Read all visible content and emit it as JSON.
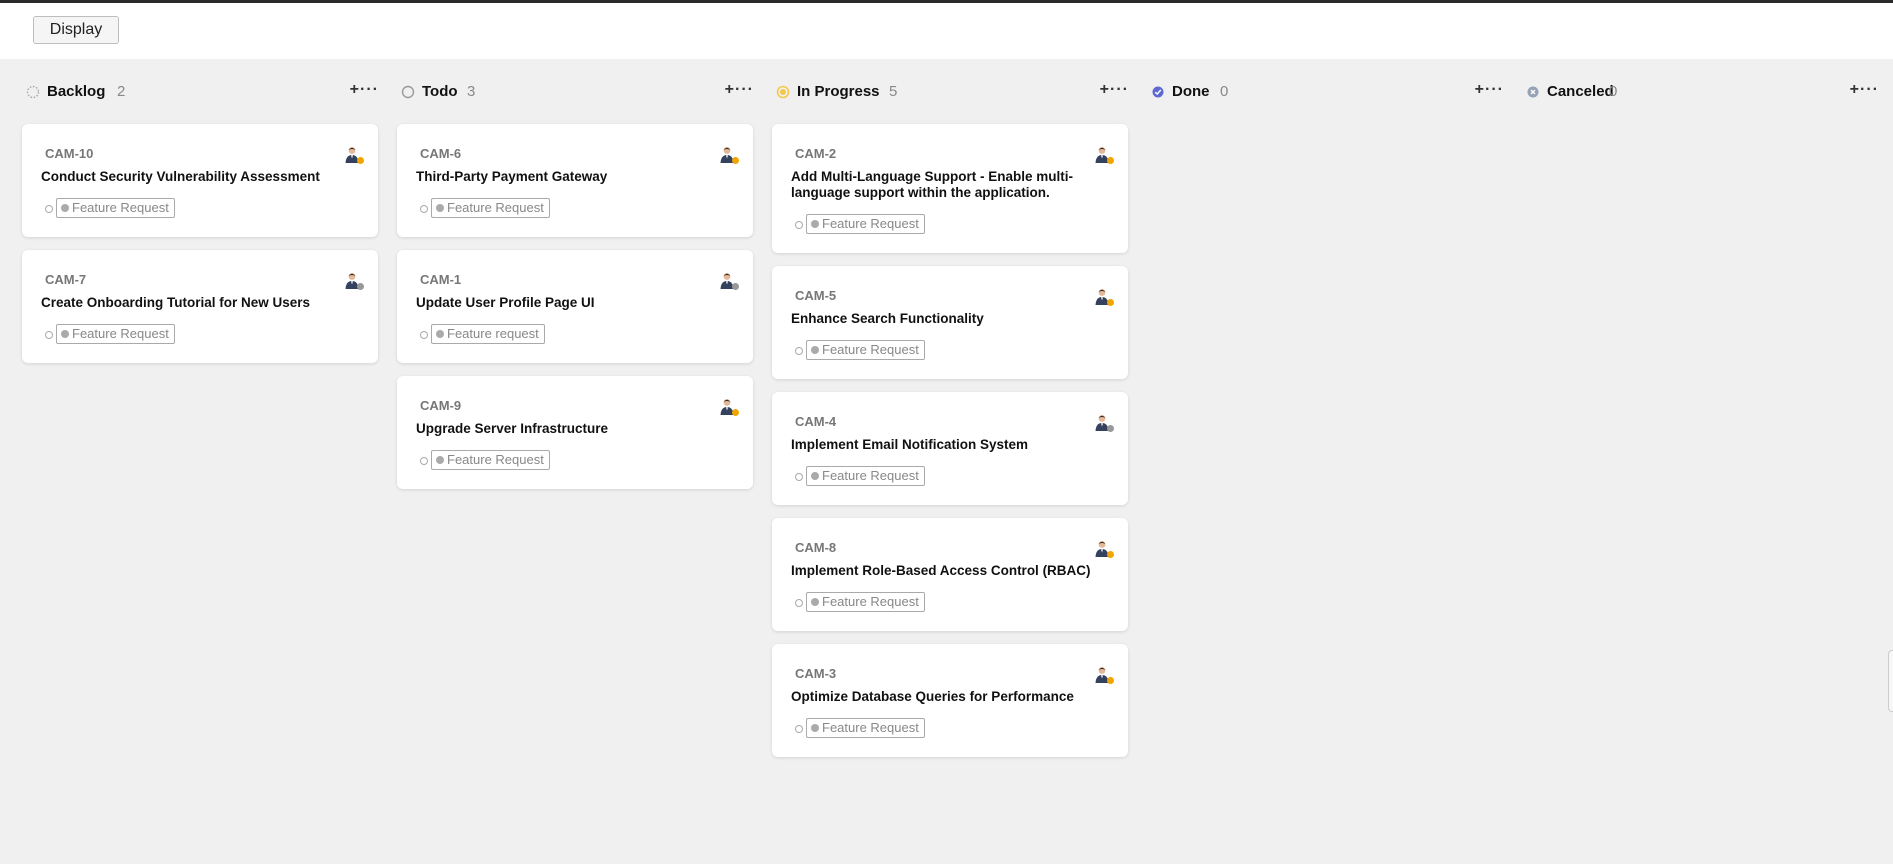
{
  "toolbar": {
    "display_label": "Display"
  },
  "columns": [
    {
      "title": "Backlog",
      "count": "2",
      "status": "backlog",
      "color": "#aaaaaa",
      "add_label": "+",
      "more_label": "···",
      "cards": [
        {
          "id": "CAM-10",
          "title": "Conduct Security Vulnerability Assessment",
          "label": "Feature Request",
          "avatar_status": "#f0a500"
        },
        {
          "id": "CAM-7",
          "title": "Create Onboarding Tutorial for New Users",
          "label": "Feature Request",
          "avatar_status": "#999999"
        }
      ]
    },
    {
      "title": "Todo",
      "count": "3",
      "status": "todo",
      "color": "#999999",
      "add_label": "+",
      "more_label": "···",
      "cards": [
        {
          "id": "CAM-6",
          "title": "Third-Party Payment Gateway",
          "label": "Feature Request",
          "avatar_status": "#f0a500"
        },
        {
          "id": "CAM-1",
          "title": "Update User Profile Page UI",
          "label": "Feature request",
          "avatar_status": "#999999"
        },
        {
          "id": "CAM-9",
          "title": "Upgrade Server Infrastructure",
          "label": "Feature Request",
          "avatar_status": "#f0a500"
        }
      ]
    },
    {
      "title": "In Progress",
      "count": "5",
      "status": "in-progress",
      "color": "#f2c94c",
      "add_label": "+",
      "more_label": "···",
      "cards": [
        {
          "id": "CAM-2",
          "title": "Add Multi-Language Support - Enable multi-language support within the application.",
          "label": "Feature Request",
          "avatar_status": "#f0a500"
        },
        {
          "id": "CAM-5",
          "title": "Enhance Search Functionality",
          "label": "Feature Request",
          "avatar_status": "#f0a500"
        },
        {
          "id": "CAM-4",
          "title": "Implement Email Notification System",
          "label": "Feature Request",
          "avatar_status": "#999999"
        },
        {
          "id": "CAM-8",
          "title": "Implement Role-Based Access Control (RBAC)",
          "label": "Feature Request",
          "avatar_status": "#f0a500"
        },
        {
          "id": "CAM-3",
          "title": "Optimize Database Queries for Performance",
          "label": "Feature Request",
          "avatar_status": "#f0a500"
        }
      ]
    },
    {
      "title": "Done",
      "count": "0",
      "status": "done",
      "color": "#5e6ad2",
      "add_label": "+",
      "more_label": "···",
      "cards": []
    },
    {
      "title": "Canceled",
      "count": "0",
      "status": "canceled",
      "color": "#95a2b3",
      "add_label": "+",
      "more_label": "···",
      "cards": []
    }
  ]
}
